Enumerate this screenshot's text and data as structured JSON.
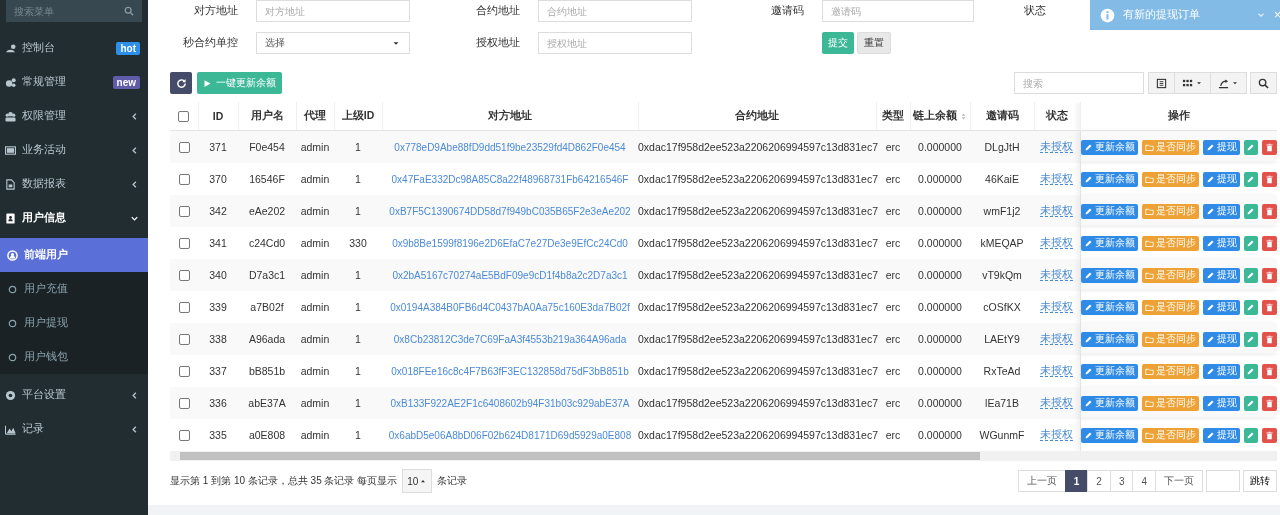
{
  "sidebar": {
    "search_placeholder": "搜索菜单",
    "items": [
      {
        "label": "控制台",
        "badge": "hot",
        "color": "#2d8fe8",
        "selected": false
      },
      {
        "label": "常规管理",
        "badge": "new",
        "color": "#605ca8",
        "selected": false
      },
      {
        "label": "权限管理",
        "expanded": false,
        "selected": false
      },
      {
        "label": "业务活动",
        "expanded": false,
        "selected": false
      },
      {
        "label": "数据报表",
        "expanded": false,
        "selected": false
      },
      {
        "label": "用户信息",
        "expanded": true,
        "selected": false,
        "children": [
          {
            "label": "前端用户",
            "selected": true
          },
          {
            "label": "用户充值",
            "selected": false
          },
          {
            "label": "用户提现",
            "selected": false
          },
          {
            "label": "用户钱包",
            "selected": false
          }
        ]
      },
      {
        "label": "平台设置",
        "expanded": false,
        "selected": false
      },
      {
        "label": "记录",
        "expanded": false,
        "selected": false
      }
    ]
  },
  "filters": [
    {
      "label": "对方地址",
      "kind": "input",
      "placeholder": "对方地址"
    },
    {
      "label": "合约地址",
      "kind": "input",
      "placeholder": "合约地址"
    },
    {
      "label": "邀请码",
      "kind": "input",
      "placeholder": "邀请码"
    },
    {
      "label": "状态",
      "kind": "label"
    },
    {
      "label": "秒合约单控",
      "kind": "select",
      "value": "选择"
    },
    {
      "label": "授权地址",
      "kind": "input",
      "placeholder": "授权地址"
    }
  ],
  "filter_buttons": [
    "提交",
    "重置"
  ],
  "toast": {
    "text": "有新的提现订单",
    "close": "×"
  },
  "toolbar": {
    "update_button": "一键更新余额",
    "search_placeholder": "搜索"
  },
  "table": {
    "header_checked": false,
    "columns": [
      {
        "label": "ID",
        "sortable": false
      },
      {
        "label": "用户名",
        "sortable": false
      },
      {
        "label": "代理",
        "sortable": false
      },
      {
        "label": "上级ID",
        "sortable": false
      },
      {
        "label": "对方地址",
        "sortable": false
      },
      {
        "label": "合约地址",
        "sortable": false
      },
      {
        "label": "类型",
        "sortable": false
      },
      {
        "label": "链上余额",
        "sortable": true
      },
      {
        "label": "邀请码",
        "sortable": false
      },
      {
        "label": "状态",
        "sortable": false
      },
      {
        "label": "操作",
        "sortable": false
      }
    ],
    "rows": [
      {
        "checked": false,
        "id": "371",
        "username": "F0e454",
        "agent": "admin",
        "parent_id": "1",
        "address": "0x778eD9Abe88fD9dd51f9be23529fd4D862F0e454",
        "contract": "0xdac17f958d2ee523a2206206994597c13d831ec7",
        "type": "erc",
        "balance": "0.000000",
        "invite_code": "DLgJtH",
        "status": "未授权",
        "actions": [
          "更新余额",
          "是否同步",
          "提现"
        ]
      },
      {
        "checked": false,
        "id": "370",
        "username": "16546F",
        "agent": "admin",
        "parent_id": "1",
        "address": "0x47FaE332Dc98A85C8a22f48968731Fb64216546F",
        "contract": "0xdac17f958d2ee523a2206206994597c13d831ec7",
        "type": "erc",
        "balance": "0.000000",
        "invite_code": "46KaiE",
        "status": "未授权",
        "actions": [
          "更新余额",
          "是否同步",
          "提现"
        ]
      },
      {
        "checked": false,
        "id": "342",
        "username": "eAe202",
        "agent": "admin",
        "parent_id": "1",
        "address": "0xB7F5C1390674DD58d7f949bC035B65F2e3eAe202",
        "contract": "0xdac17f958d2ee523a2206206994597c13d831ec7",
        "type": "erc",
        "balance": "0.000000",
        "invite_code": "wmF1j2",
        "status": "未授权",
        "actions": [
          "更新余额",
          "是否同步",
          "提现"
        ]
      },
      {
        "checked": false,
        "id": "341",
        "username": "c24Cd0",
        "agent": "admin",
        "parent_id": "330",
        "address": "0x9b8Be1599f8196e2D6EfaC7e27De3e9EfCc24Cd0",
        "contract": "0xdac17f958d2ee523a2206206994597c13d831ec7",
        "type": "erc",
        "balance": "0.000000",
        "invite_code": "kMEQAP",
        "status": "未授权",
        "actions": [
          "更新余额",
          "是否同步",
          "提现"
        ]
      },
      {
        "checked": false,
        "id": "340",
        "username": "D7a3c1",
        "agent": "admin",
        "parent_id": "1",
        "address": "0x2bA5167c70274aE5BdF09e9cD1f4b8a2c2D7a3c1",
        "contract": "0xdac17f958d2ee523a2206206994597c13d831ec7",
        "type": "erc",
        "balance": "0.000000",
        "invite_code": "vT9kQm",
        "status": "未授权",
        "actions": [
          "更新余额",
          "是否同步",
          "提现"
        ]
      },
      {
        "checked": false,
        "id": "339",
        "username": "a7B02f",
        "agent": "admin",
        "parent_id": "1",
        "address": "0x0194A384B0FB6d4C0437bA0Aa75c160E3da7B02f",
        "contract": "0xdac17f958d2ee523a2206206994597c13d831ec7",
        "type": "erc",
        "balance": "0.000000",
        "invite_code": "cOSfKX",
        "status": "未授权",
        "actions": [
          "更新余额",
          "是否同步",
          "提现"
        ]
      },
      {
        "checked": false,
        "id": "338",
        "username": "A96ada",
        "agent": "admin",
        "parent_id": "1",
        "address": "0x8Cb23812C3de7C69FaA3f4553b219a364A96ada",
        "contract": "0xdac17f958d2ee523a2206206994597c13d831ec7",
        "type": "erc",
        "balance": "0.000000",
        "invite_code": "LAEtY9",
        "status": "未授权",
        "actions": [
          "更新余额",
          "是否同步",
          "提现"
        ]
      },
      {
        "checked": false,
        "id": "337",
        "username": "bB851b",
        "agent": "admin",
        "parent_id": "1",
        "address": "0x018FEe16c8c4F7B63fF3EC132858d75dF3bB851b",
        "contract": "0xdac17f958d2ee523a2206206994597c13d831ec7",
        "type": "erc",
        "balance": "0.000000",
        "invite_code": "RxTeAd",
        "status": "未授权",
        "actions": [
          "更新余额",
          "是否同步",
          "提现"
        ]
      },
      {
        "checked": false,
        "id": "336",
        "username": "abE37A",
        "agent": "admin",
        "parent_id": "1",
        "address": "0xB133F922AE2F1c6408602b94F31b03c929abE37A",
        "contract": "0xdac17f958d2ee523a2206206994597c13d831ec7",
        "type": "erc",
        "balance": "0.000000",
        "invite_code": "lEa71B",
        "status": "未授权",
        "actions": [
          "更新余额",
          "是否同步",
          "提现"
        ]
      },
      {
        "checked": false,
        "id": "335",
        "username": "a0E808",
        "agent": "admin",
        "parent_id": "1",
        "address": "0x6abD5e06A8bD06F02b624D8171D69d5929a0E808",
        "contract": "0xdac17f958d2ee523a2206206994597c13d831ec7",
        "type": "erc",
        "balance": "0.000000",
        "invite_code": "WGunmF",
        "status": "未授权",
        "actions": [
          "更新余额",
          "是否同步",
          "提现"
        ]
      }
    ]
  },
  "pagination": {
    "info": "显示第 1 到第 10 条记录，总共 35 条记录 每页显示",
    "page_size": "10",
    "suffix": "条记录",
    "pages": [
      {
        "label": "上一页",
        "selected": false
      },
      {
        "label": "1",
        "selected": true
      },
      {
        "label": "2",
        "selected": false
      },
      {
        "label": "3",
        "selected": false
      },
      {
        "label": "4",
        "selected": false
      },
      {
        "label": "下一页",
        "selected": false
      }
    ],
    "jump_button": "跳转"
  }
}
